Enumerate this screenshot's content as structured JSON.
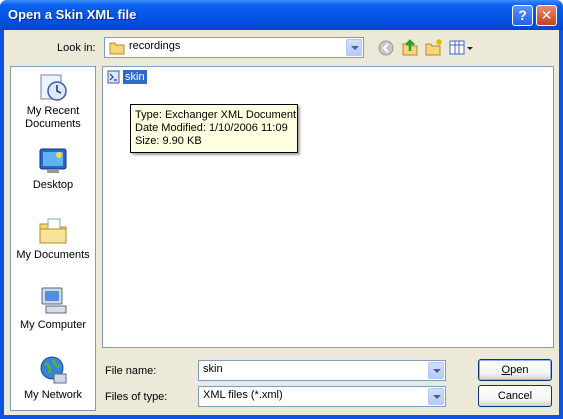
{
  "window": {
    "title": "Open a Skin XML file",
    "help_glyph": "?",
    "close_glyph": "✕"
  },
  "lookin": {
    "label": "Look in:",
    "value": "recordings"
  },
  "toolbar": [
    "back-icon",
    "up-folder-icon",
    "new-folder-icon",
    "views-menu-icon"
  ],
  "places": [
    {
      "label": "My Recent Documents",
      "icon": "recent-documents-icon"
    },
    {
      "label": "Desktop",
      "icon": "desktop-icon"
    },
    {
      "label": "My Documents",
      "icon": "my-documents-icon"
    },
    {
      "label": "My Computer",
      "icon": "my-computer-icon"
    },
    {
      "label": "My Network",
      "icon": "my-network-icon"
    }
  ],
  "files": [
    {
      "name": "skin",
      "icon": "xml-file-icon",
      "selected": true
    }
  ],
  "tooltip": {
    "type": "Type: Exchanger XML Document",
    "modified": "Date Modified: 1/10/2006 11:09",
    "size": "Size: 9.90 KB"
  },
  "filename": {
    "label": "File name:",
    "value": "skin"
  },
  "filetype": {
    "label": "Files of type:",
    "value": "XML files (*.xml)"
  },
  "buttons": {
    "open": "Open",
    "cancel": "Cancel"
  },
  "colors": {
    "titlebar": "#0553e3",
    "face": "#ece9d8",
    "selection": "#316ac5",
    "tooltip_bg": "#ffffe1"
  }
}
